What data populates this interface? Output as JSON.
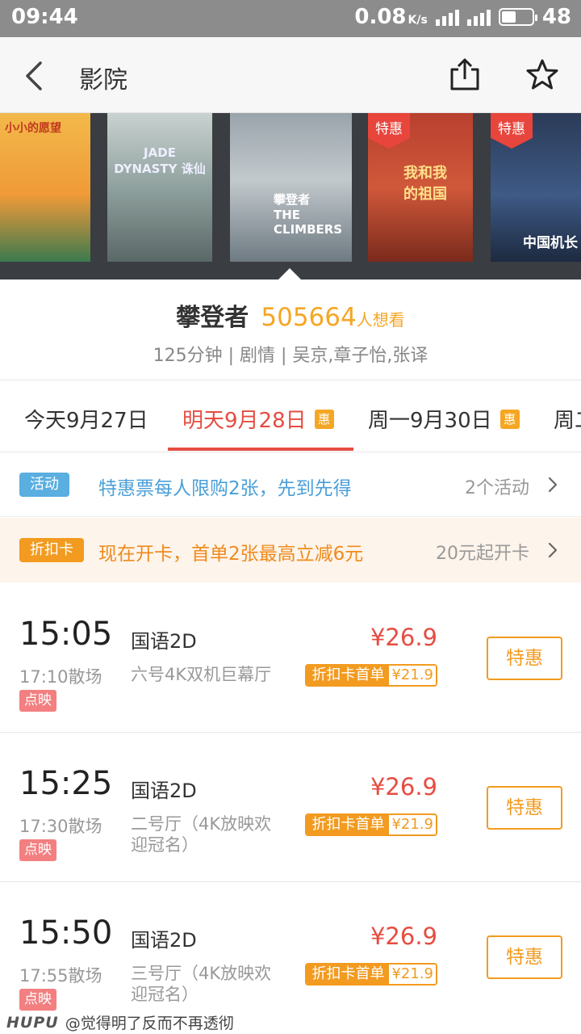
{
  "status_bar": {
    "time": "09:44",
    "net_speed": "0.08",
    "net_unit": "K/s",
    "battery": "48",
    "battery_level_pct": 48
  },
  "nav": {
    "title": "影院",
    "back_icon": "chevron-left-icon",
    "share_icon": "share-icon",
    "favorite_icon": "star-icon"
  },
  "posters": [
    {
      "title": "小小的愿望",
      "tag": ""
    },
    {
      "title": "JADE DYNASTY 诛仙",
      "tag": ""
    },
    {
      "title": "攀登者 THE CLIMBERS",
      "tag": ""
    },
    {
      "title": "我和我的祖国",
      "tag": "特惠"
    },
    {
      "title": "中国机长",
      "tag": "特惠"
    }
  ],
  "movie": {
    "name": "攀登者",
    "want_count": "505664",
    "want_label": "人想看",
    "meta": "125分钟 | 剧情 | 吴京,章子怡,张译"
  },
  "date_tabs": [
    {
      "label": "今天9月27日",
      "badge": ""
    },
    {
      "label": "明天9月28日",
      "badge": "惠"
    },
    {
      "label": "周一9月30日",
      "badge": "惠"
    },
    {
      "label": "周二",
      "badge": ""
    }
  ],
  "activity": {
    "chip": "活动",
    "text": "特惠票每人限购2张，先到先得",
    "right": "2个活动"
  },
  "discount_card": {
    "chip": "折扣卡",
    "text": "现在开卡，首单2张最高立减6元",
    "right": "20元起开卡"
  },
  "showtimes": [
    {
      "start": "15:05",
      "end": "17:10散场",
      "badge": "点映",
      "lang": "国语2D",
      "hall": "六号4K双机巨幕厅",
      "price": "¥26.9",
      "disc_label": "折扣卡首单",
      "disc_price": "¥21.9",
      "button": "特惠"
    },
    {
      "start": "15:25",
      "end": "17:30散场",
      "badge": "点映",
      "lang": "国语2D",
      "hall": "二号厅（4K放映欢迎冠名）",
      "price": "¥26.9",
      "disc_label": "折扣卡首单",
      "disc_price": "¥21.9",
      "button": "特惠"
    },
    {
      "start": "15:50",
      "end": "17:55散场",
      "badge": "点映",
      "lang": "国语2D",
      "hall": "三号厅（4K放映欢迎冠名）",
      "price": "¥26.9",
      "disc_label": "折扣卡首单",
      "disc_price": "¥21.9",
      "button": "特惠"
    }
  ],
  "watermark": {
    "logo": "HUPU",
    "text": "@觉得明了反而不再透彻"
  }
}
